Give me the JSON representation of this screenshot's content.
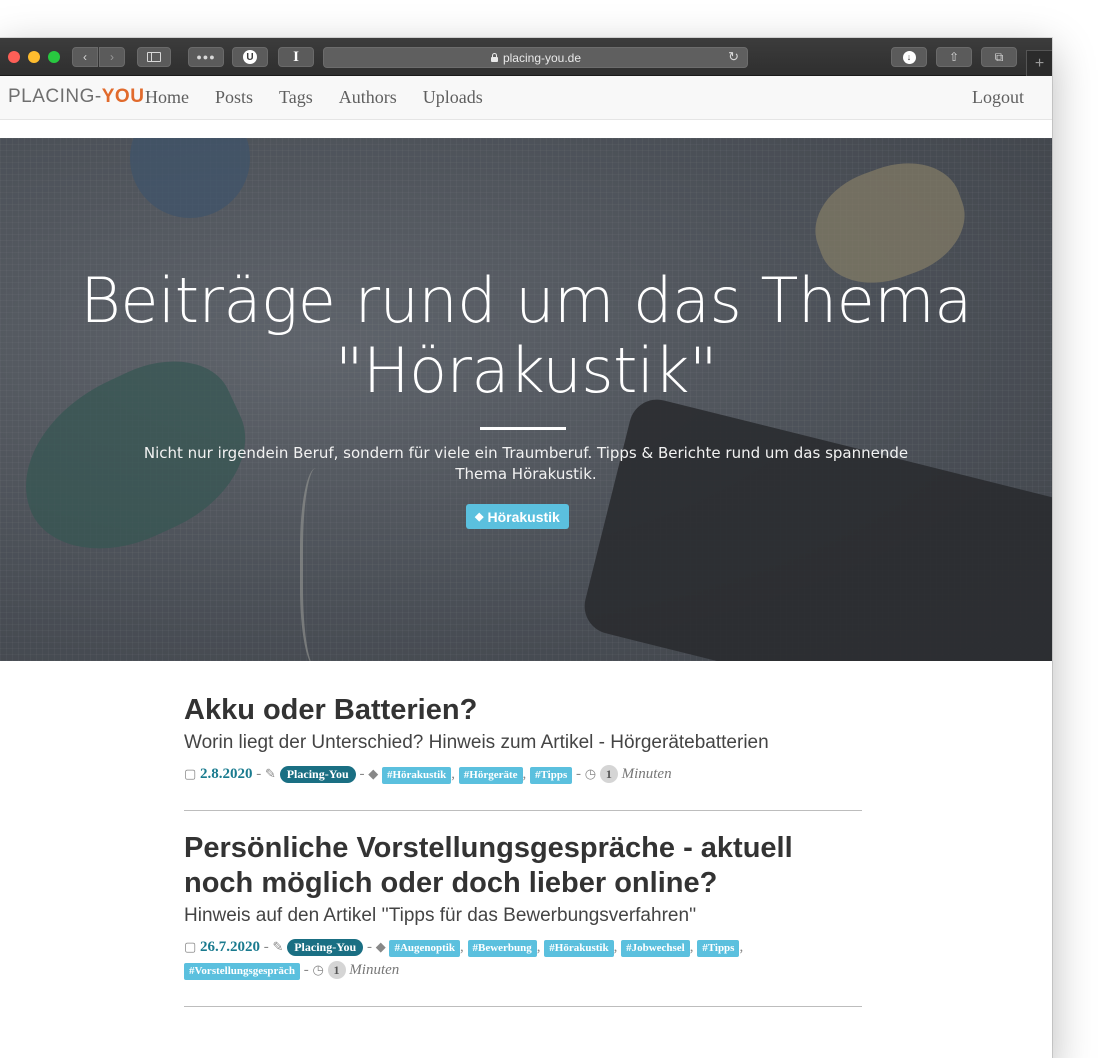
{
  "browser": {
    "url": "placing-you.de"
  },
  "nav": {
    "logo_main": "PLACING-",
    "logo_accent": "YOU",
    "links": [
      "Home",
      "Posts",
      "Tags",
      "Authors",
      "Uploads"
    ],
    "logout": "Logout"
  },
  "hero": {
    "title_line1": "Beiträge rund um das Thema",
    "title_line2": "\"Hörakustik\"",
    "subtitle": "Nicht nur irgendein Beruf, sondern für viele ein Traumberuf. Tipps & Berichte rund um das spannende Thema Hörakustik.",
    "tag": "Hörakustik"
  },
  "posts": [
    {
      "title": "Akku oder Batterien?",
      "subtitle": "Worin liegt der Unterschied? Hinweis zum Artikel - Hörgerätebatterien",
      "date": "2.8.2020",
      "author": "Placing-You",
      "tags": [
        "#Hörakustik",
        "#Hörgeräte",
        "#Tipps"
      ],
      "read_time": "1",
      "read_unit": "Minuten"
    },
    {
      "title": "Persönliche Vorstellungsgespräche - aktuell noch möglich oder doch lieber online?",
      "subtitle": "Hinweis auf den Artikel ''Tipps für das Bewerbungsverfahren''",
      "date": "26.7.2020",
      "author": "Placing-You",
      "tags": [
        "#Augenoptik",
        "#Bewerbung",
        "#Hörakustik",
        "#Jobwechsel",
        "#Tipps",
        "#Vorstellungsgespräch"
      ],
      "read_time": "1",
      "read_unit": "Minuten"
    }
  ],
  "colors": {
    "accent": "#e16a2c",
    "tag": "#5bc0de",
    "author_badge": "#1a6f83",
    "date": "#1a7b8f"
  }
}
